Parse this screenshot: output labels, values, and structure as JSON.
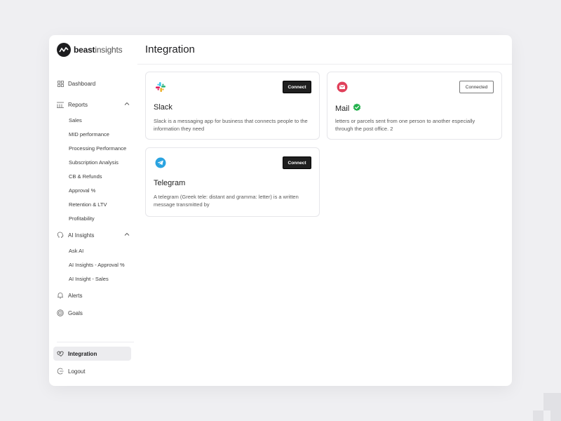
{
  "brand": {
    "name_bold": "beast",
    "name_light": "insights"
  },
  "sidebar": {
    "dashboard": "Dashboard",
    "reports": {
      "label": "Reports",
      "items": [
        "Sales",
        "MID performance",
        "Processing Performance",
        "Subscription Analysis",
        "CB & Refunds",
        "Approval %",
        "Retention & LTV",
        "Profitability"
      ]
    },
    "ai_insights": {
      "label": "AI Insights",
      "items": [
        "Ask AI",
        "AI Insights - Approval %",
        "AI Insight - Sales"
      ]
    },
    "alerts": "Alerts",
    "goals": "Goals",
    "integration": "Integration",
    "logout": "Logout"
  },
  "page": {
    "title": "Integration"
  },
  "integrations": [
    {
      "name": "Slack",
      "icon": "slack-icon",
      "description": "Slack is a messaging app for business that connects people to the information they need",
      "button": "Connect",
      "verified": false
    },
    {
      "name": "Mail",
      "icon": "mail-icon",
      "description": "letters or parcels sent from one person to another especially through the post office. 2",
      "button": "Connected",
      "verified": true
    },
    {
      "name": "Telegram",
      "icon": "telegram-icon",
      "description": "A telegram (Greek tele: distant and gramma: letter) is a written message transmitted by",
      "button": "Connect",
      "verified": false
    }
  ],
  "colors": {
    "background": "#efeff2",
    "button_dark": "#1f1f1f",
    "verified_green": "#22b14c",
    "mail_red": "#e0405a",
    "telegram_blue": "#2aa3e0"
  }
}
